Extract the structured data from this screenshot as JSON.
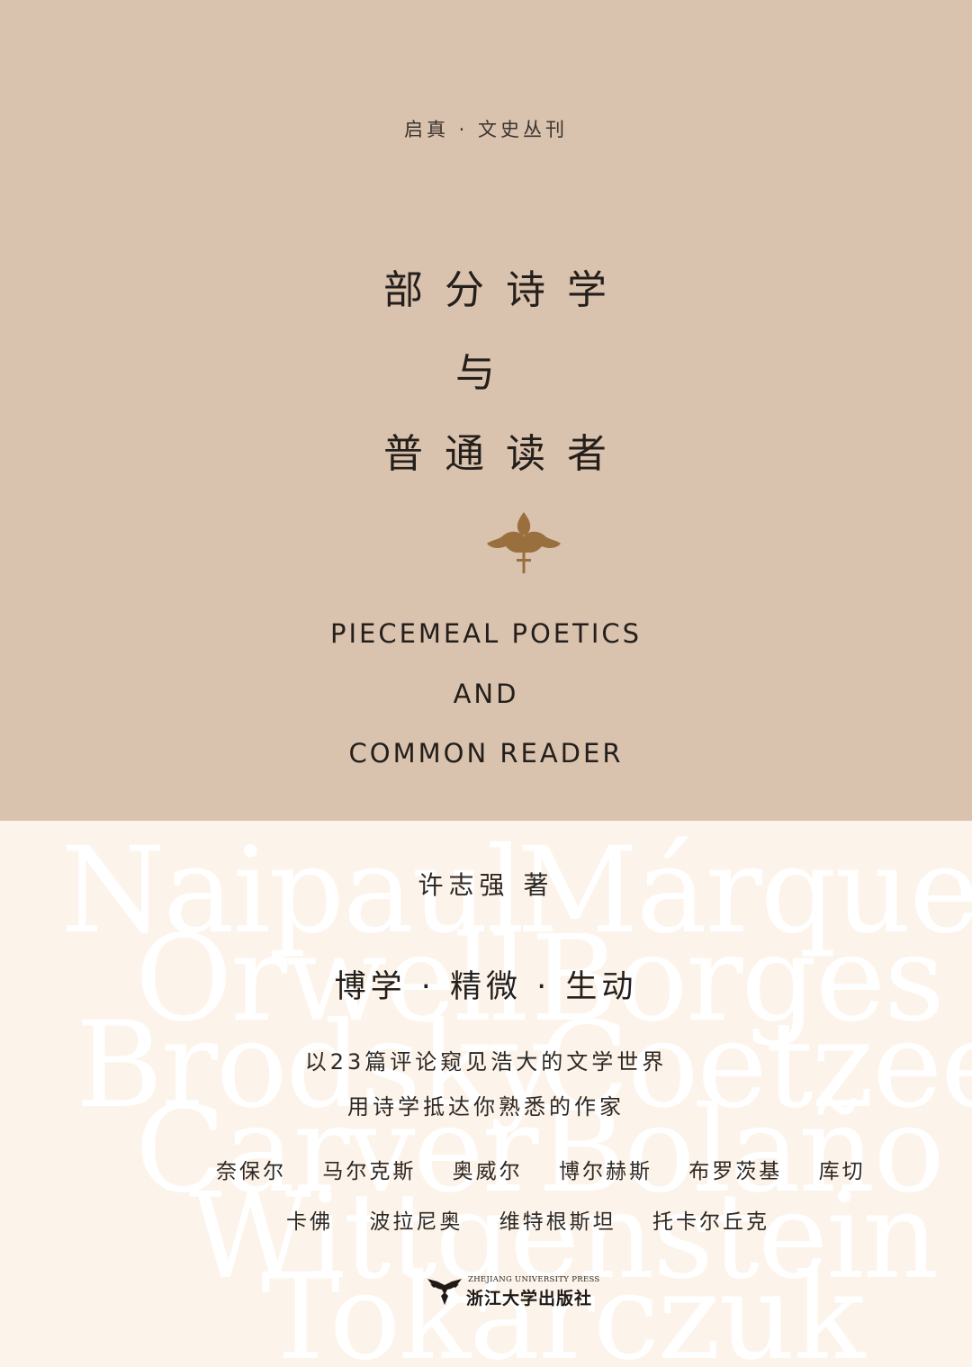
{
  "cover": {
    "series": "启真 · 文史丛刊",
    "title_cn": [
      "部分诗学",
      "与",
      "普通读者"
    ],
    "title_en": [
      "PIECEMEAL POETICS",
      "AND",
      "COMMON READER"
    ],
    "author": "许志强 著",
    "tagline": "博学 · 精微 · 生动",
    "subtitle": [
      "以23篇评论窥见浩大的文学世界",
      "用诗学抵达你熟悉的作家"
    ],
    "writers_row1": [
      "奈保尔",
      "马尔克斯",
      "奥威尔",
      "博尔赫斯",
      "布罗茨基",
      "库切"
    ],
    "writers_row2": [
      "卡佛",
      "波拉尼奥",
      "维特根斯坦",
      "托卡尔丘克"
    ],
    "background_names": [
      "Naipaul",
      "Márquez",
      "Orwell",
      "Borges",
      "Brodsky",
      "Coetzee",
      "Carver",
      "Bolaño",
      "Wittgenstein",
      "Tokarczuk"
    ],
    "publisher_en": "ZHEJIANG UNIVERSITY PRESS",
    "publisher_cn": "浙江大学出版社",
    "ornament_icon": "fleur-de-lis-icon",
    "publisher_icon": "eagle-logo-icon",
    "colors": {
      "top_band": "#d9c2ae",
      "bottom_band": "#fcf3ea",
      "ornament": "#9a6f3e",
      "text": "#241f1b"
    }
  }
}
